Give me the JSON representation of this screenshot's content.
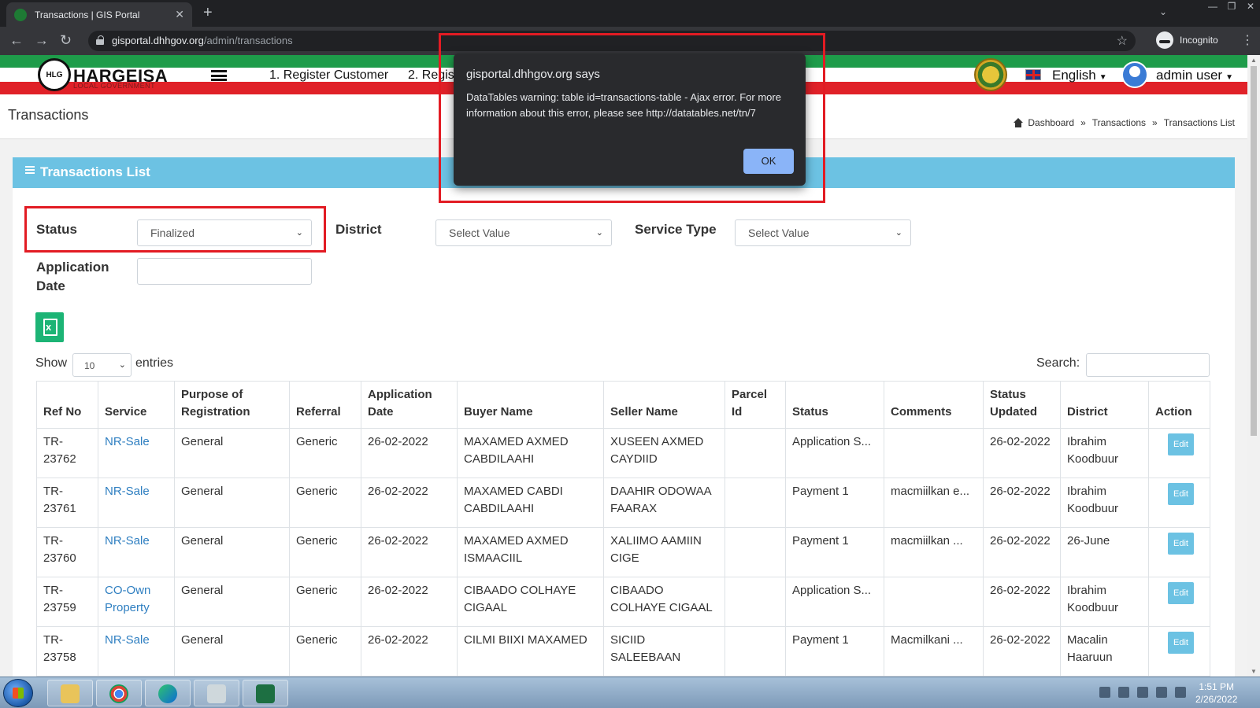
{
  "browser": {
    "tab_title": "Transactions | GIS Portal",
    "url_host": "gisportal.dhhgov.org",
    "url_path": "/admin/transactions",
    "profile": "Incognito"
  },
  "header": {
    "brand": "HARGEISA",
    "brand_sub": "LOCAL GOVERNMENT",
    "menu": [
      "1. Register Customer",
      "2. Regis"
    ],
    "language": "English",
    "user": "admin user"
  },
  "page": {
    "title": "Transactions",
    "breadcrumbs": [
      "Dashboard",
      "Transactions",
      "Transactions List"
    ]
  },
  "card": {
    "title": "Transactions List"
  },
  "filters": {
    "status_label": "Status",
    "status_value": "Finalized",
    "district_label": "District",
    "district_value": "Select Value",
    "service_label": "Service Type",
    "service_value": "Select Value",
    "appdate_label_1": "Application",
    "appdate_label_2": "Date"
  },
  "list_controls": {
    "show": "Show",
    "length": "10",
    "entries": "entries",
    "search": "Search:"
  },
  "table": {
    "columns": [
      "Ref No",
      "Service",
      "Purpose of Registration",
      "Referral",
      "Application Date",
      "Buyer Name",
      "Seller Name",
      "Parcel Id",
      "Status",
      "Comments",
      "Status Updated",
      "District",
      "Action"
    ],
    "edit_label": "Edit",
    "rows": [
      {
        "ref": "TR-23762",
        "service": "NR-Sale",
        "purpose": "General",
        "referral": "Generic",
        "app_date": "26-02-2022",
        "buyer": "MAXAMED AXMED CABDILAAHI",
        "seller": "XUSEEN AXMED CAYDIID",
        "parcel": "",
        "status": "Application S...",
        "comments": "",
        "updated": "26-02-2022",
        "district": "Ibrahim Koodbuur"
      },
      {
        "ref": "TR-23761",
        "service": "NR-Sale",
        "purpose": "General",
        "referral": "Generic",
        "app_date": "26-02-2022",
        "buyer": "MAXAMED CABDI CABDILAAHI",
        "seller": "DAAHIR ODOWAA FAARAX",
        "parcel": "",
        "status": "Payment 1",
        "comments": "macmiilkan e...",
        "updated": "26-02-2022",
        "district": "Ibrahim Koodbuur"
      },
      {
        "ref": "TR-23760",
        "service": "NR-Sale",
        "purpose": "General",
        "referral": "Generic",
        "app_date": "26-02-2022",
        "buyer": "MAXAMED AXMED ISMAACIIL",
        "seller": "XALIIMO AAMIIN CIGE",
        "parcel": "",
        "status": "Payment 1",
        "comments": "macmiilkan ...",
        "updated": "26-02-2022",
        "district": "26-June"
      },
      {
        "ref": "TR-23759",
        "service": "CO-Own Property",
        "purpose": "General",
        "referral": "Generic",
        "app_date": "26-02-2022",
        "buyer": "CIBAADO COLHAYE CIGAAL",
        "seller": "CIBAADO COLHAYE CIGAAL",
        "parcel": "",
        "status": "Application S...",
        "comments": "",
        "updated": "26-02-2022",
        "district": "Ibrahim Koodbuur"
      },
      {
        "ref": "TR-23758",
        "service": "NR-Sale",
        "purpose": "General",
        "referral": "Generic",
        "app_date": "26-02-2022",
        "buyer": "CILMI BIIXI MAXAMED",
        "seller": "SICIID SALEEBAAN",
        "parcel": "",
        "status": "Payment 1",
        "comments": "Macmilkani ...",
        "updated": "26-02-2022",
        "district": "Macalin Haaruun"
      }
    ]
  },
  "dialog": {
    "title": "gisportal.dhhgov.org says",
    "message": "DataTables warning: table id=transactions-table - Ajax error. For more information about this error, please see http://datatables.net/tn/7",
    "ok": "OK"
  },
  "taskbar": {
    "time": "1:51 PM",
    "date": "2/26/2022"
  },
  "colors": {
    "accent": "#6cc2e3",
    "highlight": "#e21b23",
    "dialog_bg": "#292a2d"
  }
}
